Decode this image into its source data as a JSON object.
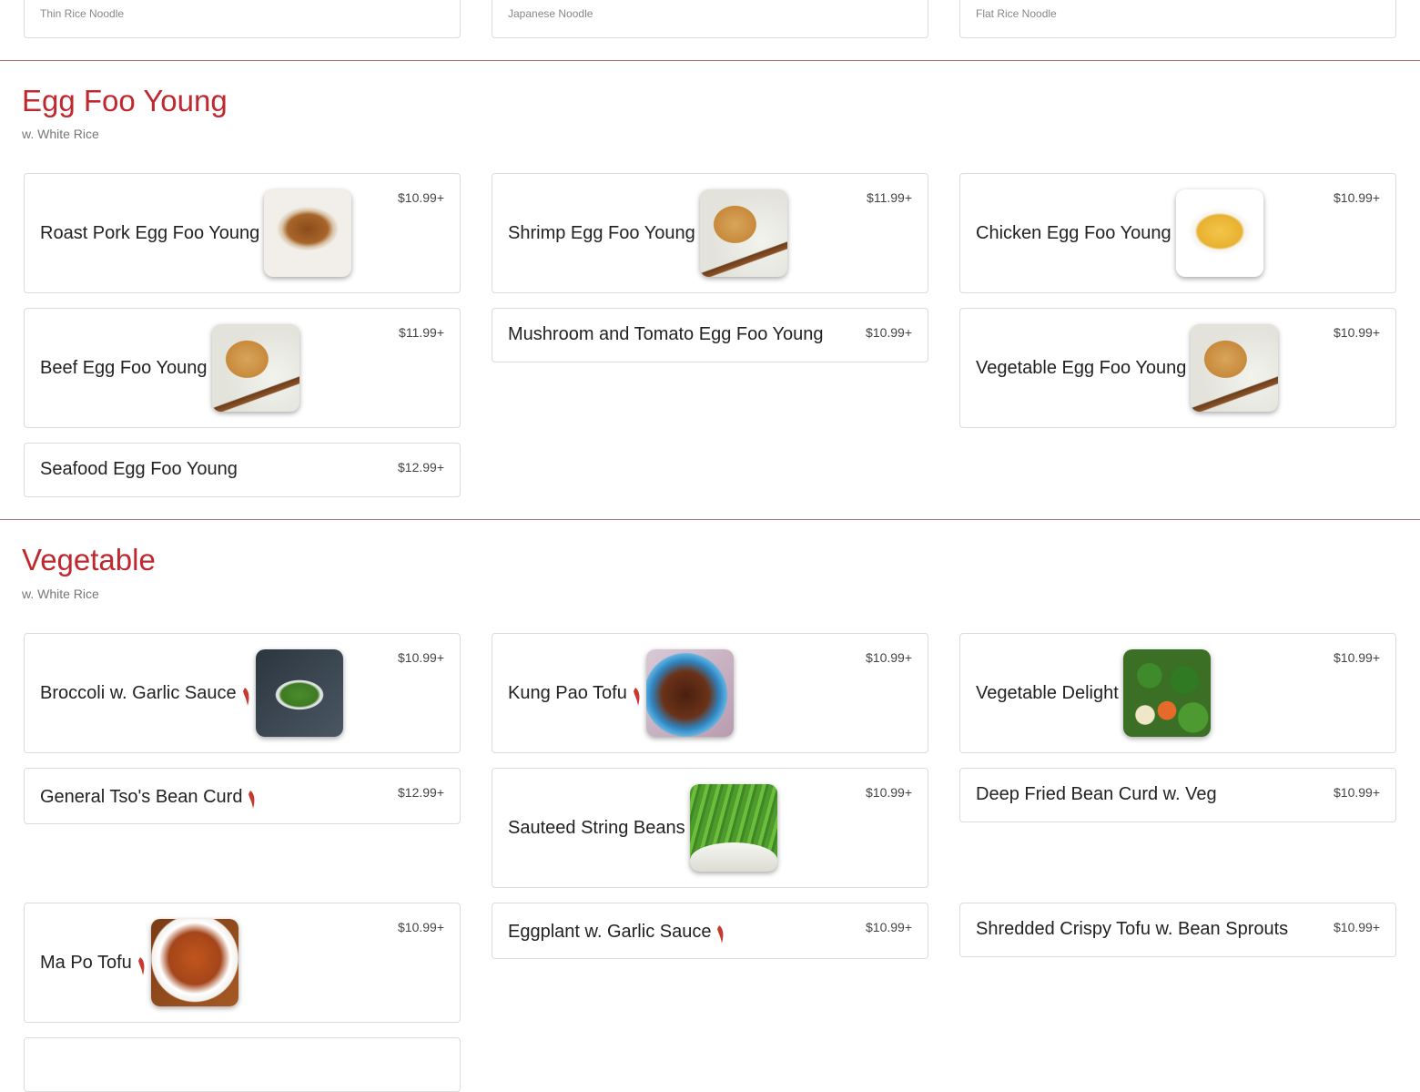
{
  "prev_section": {
    "items": [
      {
        "subtitle": "Thin Rice Noodle"
      },
      {
        "subtitle": "Japanese Noodle"
      },
      {
        "subtitle": "Flat Rice Noodle"
      }
    ]
  },
  "sections": [
    {
      "title": "Egg Foo Young",
      "subtitle": "w. White Rice",
      "items": [
        {
          "name": "Roast Pork Egg Foo Young",
          "price": "$10.99+",
          "image": "omelet-sauce"
        },
        {
          "name": "Shrimp Egg Foo Young",
          "price": "$11.99+",
          "image": "omelet-rice"
        },
        {
          "name": "Chicken Egg Foo Young",
          "price": "$10.99+",
          "image": "omelet-plain"
        },
        {
          "name": "Beef Egg Foo Young",
          "price": "$11.99+",
          "image": "omelet-rice"
        },
        {
          "name": "Mushroom and Tomato Egg Foo Young",
          "price": "$10.99+"
        },
        {
          "name": "Vegetable Egg Foo Young",
          "price": "$10.99+",
          "image": "omelet-rice"
        },
        {
          "name": "Seafood Egg Foo Young",
          "price": "$12.99+"
        }
      ]
    },
    {
      "title": "Vegetable",
      "subtitle": "w. White Rice",
      "items": [
        {
          "name": "Broccoli w. Garlic Sauce",
          "price": "$10.99+",
          "spicy": true,
          "image": "broccoli"
        },
        {
          "name": "Kung Pao Tofu",
          "price": "$10.99+",
          "spicy": true,
          "image": "kungpao"
        },
        {
          "name": "Vegetable Delight",
          "price": "$10.99+",
          "image": "veg"
        },
        {
          "name": "General Tso's Bean Curd",
          "price": "$12.99+",
          "spicy": true
        },
        {
          "name": "Sauteed String Beans",
          "price": "$10.99+",
          "image": "beans"
        },
        {
          "name": "Deep Fried Bean Curd w. Veg",
          "price": "$10.99+"
        },
        {
          "name": "Ma Po Tofu",
          "price": "$10.99+",
          "spicy": true,
          "image": "mapo"
        },
        {
          "name": "Eggplant w. Garlic Sauce",
          "price": "$10.99+",
          "spicy": true
        },
        {
          "name": "Shredded Crispy Tofu w. Bean Sprouts",
          "price": "$10.99+"
        }
      ]
    }
  ],
  "icons": {
    "spicy": "chili-pepper-icon"
  },
  "colors": {
    "accent": "#c0282f",
    "divider": "#a86a6a",
    "chili": "#c7392f"
  }
}
